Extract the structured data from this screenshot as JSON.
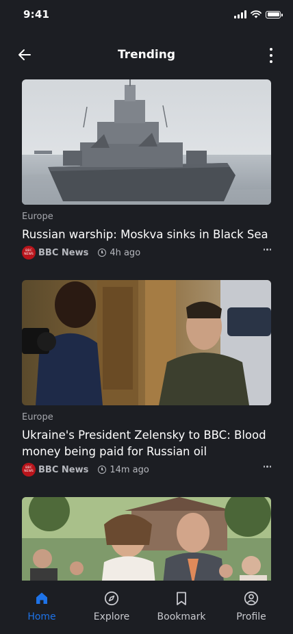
{
  "status": {
    "time": "9:41"
  },
  "header": {
    "title": "Trending"
  },
  "articles": [
    {
      "category": "Europe",
      "headline": "Russian warship: Moskva sinks in Black Sea",
      "source": "BBC News",
      "time_ago": "4h ago",
      "image": "warship-photo"
    },
    {
      "category": "Europe",
      "headline": "Ukraine's President Zelensky to BBC: Blood money being paid for Russian oil",
      "source": "BBC News",
      "time_ago": "14m ago",
      "image": "interview-photo"
    },
    {
      "image": "wedding-photo"
    }
  ],
  "tabs": [
    {
      "label": "Home",
      "icon": "home-icon",
      "active": true
    },
    {
      "label": "Explore",
      "icon": "compass-icon",
      "active": false
    },
    {
      "label": "Bookmark",
      "icon": "bookmark-icon",
      "active": false
    },
    {
      "label": "Profile",
      "icon": "user-circle-icon",
      "active": false
    }
  ],
  "colors": {
    "background": "#1c1e23",
    "accent": "#1e73e8",
    "source_badge": "#b8141b",
    "muted_text": "#a6a8ae"
  }
}
